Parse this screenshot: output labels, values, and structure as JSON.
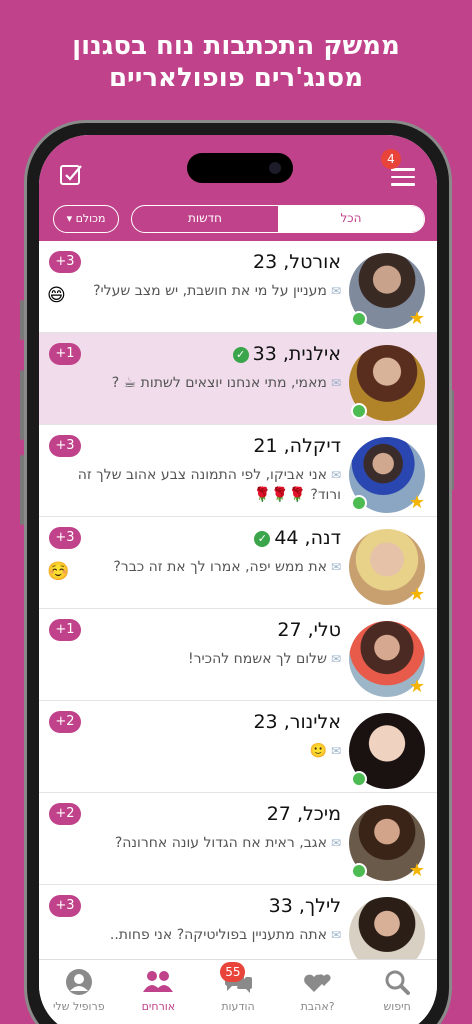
{
  "promo": {
    "line1": "ממשק התכתבות נוח בסגנון",
    "line2": "מסנג'רים פופולאריים"
  },
  "header": {
    "menu_badge": "4",
    "tabs": {
      "all": "הכל",
      "new": "חדשות"
    },
    "filter_label": "מכולם ▾"
  },
  "colors": {
    "brand": "#c0428a",
    "online": "#4cbb52",
    "badge": "#e8443a",
    "star": "#f5b400"
  },
  "conversations": [
    {
      "name": "אורטל, 23",
      "message": "מעניין על מי את חושבת, יש מצב שעלי?",
      "count": "+3",
      "online": true,
      "star": true,
      "verified": false,
      "highlight": false,
      "emoji": "😄"
    },
    {
      "name": "אילנית, 33",
      "message": "מאמי, מתי אנחנו יוצאים לשתות ☕ ?",
      "count": "+1",
      "online": true,
      "star": false,
      "verified": true,
      "highlight": true,
      "emoji": ""
    },
    {
      "name": "דיקלה, 21",
      "message": "אני אביקו, לפי התמונה צבע אהוב שלך זה ורוד? 🌹🌹🌹",
      "count": "+3",
      "online": true,
      "star": true,
      "verified": false,
      "highlight": false,
      "emoji": ""
    },
    {
      "name": "דנה, 44",
      "message": "את ממש יפה, אמרו לך את זה כבר?",
      "count": "+3",
      "online": false,
      "star": true,
      "verified": true,
      "highlight": false,
      "emoji": "☺️"
    },
    {
      "name": "טלי, 27",
      "message": "שלום לך אשמח להכיר!",
      "count": "+1",
      "online": false,
      "star": true,
      "verified": false,
      "highlight": false,
      "emoji": ""
    },
    {
      "name": "אלינור, 23",
      "message": "🙂",
      "count": "+2",
      "online": true,
      "star": false,
      "verified": false,
      "highlight": false,
      "emoji": ""
    },
    {
      "name": "מיכל, 27",
      "message": "אגב, ראית אח הגדול עונה אחרונה?",
      "count": "+2",
      "online": true,
      "star": true,
      "verified": false,
      "highlight": false,
      "emoji": ""
    },
    {
      "name": "לילך, 33",
      "message": "אתה מתעניין בפוליטיקה? אני פחות..",
      "count": "+3",
      "online": false,
      "star": false,
      "verified": false,
      "highlight": false,
      "emoji": ""
    }
  ],
  "tabbar": {
    "items": [
      {
        "label": "פרופיל שלי",
        "icon": "profile-icon"
      },
      {
        "label": "אורחים",
        "icon": "guests-icon",
        "active": true
      },
      {
        "label": "הודעות",
        "icon": "messages-icon",
        "badge": "55"
      },
      {
        "label": "אהבת?",
        "icon": "hearts-icon"
      },
      {
        "label": "חיפוש",
        "icon": "search-icon"
      }
    ]
  }
}
